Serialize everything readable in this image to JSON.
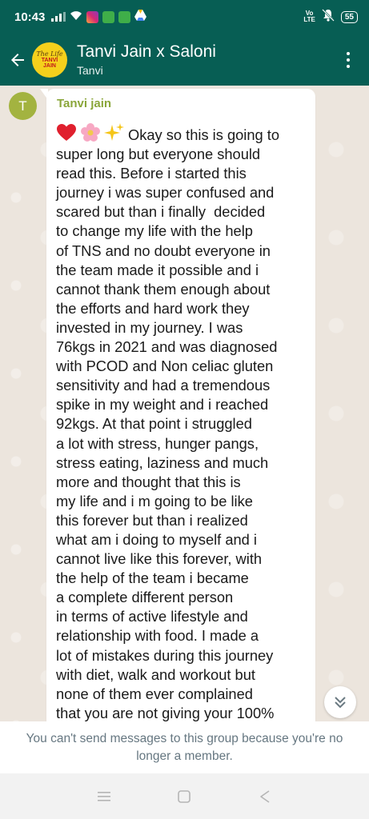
{
  "status_bar": {
    "time": "10:43",
    "volte_top": "Vo",
    "volte_bottom": "LTE",
    "battery": "55"
  },
  "header": {
    "title": "Tanvi Jain x Saloni",
    "subtitle": "Tanvi",
    "avatar_logo_script": "The Life",
    "avatar_logo_name_line1": "TANVI",
    "avatar_logo_name_line2": "JAIN"
  },
  "message": {
    "avatar_letter": "T",
    "sender": "Tanvi jain",
    "emojis": [
      "heart-emoji",
      "cherry-blossom-emoji",
      "sparkles-emoji"
    ],
    "text": "Okay so this is going to\nsuper long but everyone should\nread this. Before i started this\njourney i was super confused and\nscared but than i finally  decided\nto change my life with the help\nof TNS and no doubt everyone in\nthe team made it possible and i\ncannot thank them enough about\nthe efforts and hard work they\ninvested in my journey. I was\n76kgs in 2021 and was diagnosed\nwith PCOD and Non celiac gluten\nsensitivity and had a tremendous\nspike in my weight and i reached\n92kgs. At that point i struggled\na lot with stress, hunger pangs,\nstress eating, laziness and much\nmore and thought that this is\nmy life and i m going to be like\nthis forever but than i realized\nwhat am i doing to myself and i\ncannot live like this forever, with\nthe help of the team i became\na complete different person\nin terms of active lifestyle and\nrelationship with food. I made a\nlot of mistakes during this journey\nwith diet, walk and workout but\nnone of them ever complained\nthat you are not giving your 100%"
  },
  "footer": {
    "notice": "You can't send messages to this group because you're no longer a member."
  },
  "colors": {
    "header_bg": "#075e54",
    "sender_name": "#8aa63a",
    "avatar_bg": "#a3b340",
    "footer_text": "#667781"
  }
}
